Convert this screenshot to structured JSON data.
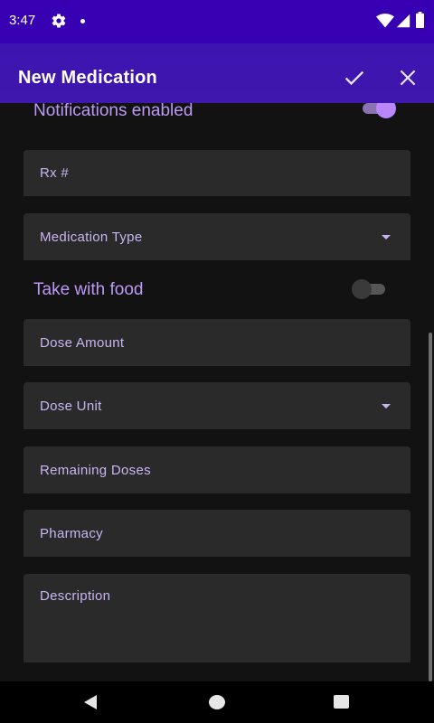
{
  "status_bar": {
    "time": "3:47"
  },
  "app_bar": {
    "title": "New Medication",
    "confirm_icon": "check-icon",
    "close_icon": "close-icon"
  },
  "form": {
    "notifications_label": "Notifications enabled",
    "notifications_enabled": true,
    "rx_label": "Rx #",
    "medication_type_label": "Medication Type",
    "take_with_food_label": "Take with food",
    "take_with_food_enabled": false,
    "dose_amount_label": "Dose Amount",
    "dose_unit_label": "Dose Unit",
    "remaining_doses_label": "Remaining Doses",
    "pharmacy_label": "Pharmacy",
    "description_label": "Description"
  },
  "colors": {
    "status_bar": "#3700b3",
    "app_bar": "#3f17ad",
    "accent": "#bb86fc",
    "background": "#121212",
    "field_background": "#2a2a2a"
  }
}
